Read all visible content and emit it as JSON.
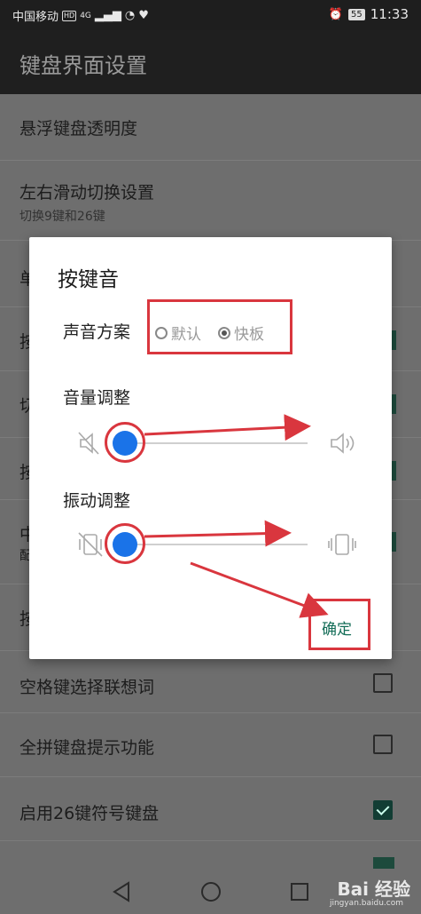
{
  "status": {
    "carrier": "中国移动",
    "hd": "HD",
    "signal": "4G",
    "battery": "55",
    "time": "11:33"
  },
  "appbar": {
    "title": "键盘界面设置"
  },
  "settings": {
    "floating_opacity": "悬浮键盘透明度",
    "swipe_switch": {
      "title": "左右滑动切换设置",
      "subtitle": "切换9键和26键"
    },
    "row_partial_1": "单",
    "row_partial_2": "按",
    "row_partial_3": "切",
    "row_partial_4": "按",
    "row_partial_5": "中",
    "row_partial_5_sub": "配",
    "row_partial_6": "按",
    "space_predict": {
      "label": "空格键选择联想词",
      "checked": false
    },
    "pinyin_hint": {
      "label": "全拼键盘提示功能",
      "checked": false
    },
    "symbol26": {
      "label": "启用26键符号键盘",
      "checked": true
    }
  },
  "dialog": {
    "title": "按键音",
    "sound_scheme_label": "声音方案",
    "options": [
      "默认",
      "快板"
    ],
    "selected_option": "快板",
    "volume_label": "音量调整",
    "volume_level": 0.05,
    "vibration_label": "振动调整",
    "vibration_level": 0.05,
    "confirm": "确定"
  },
  "watermark": {
    "brand": "Bai 经验",
    "url": "jingyan.baidu.com"
  },
  "colors": {
    "accent": "#1a73e8",
    "annotation": "#d9363e",
    "confirm": "#136d57"
  }
}
